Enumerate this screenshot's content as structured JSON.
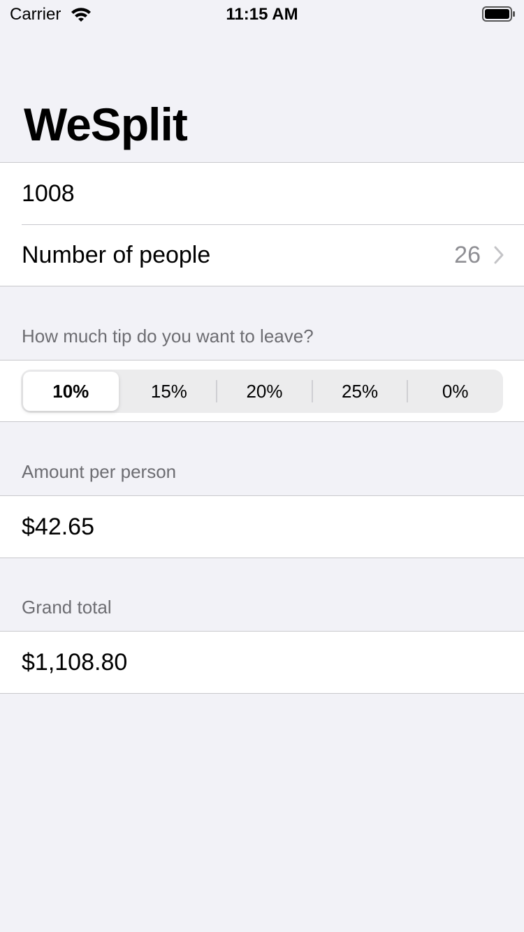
{
  "status_bar": {
    "carrier": "Carrier",
    "time": "11:15 AM"
  },
  "nav": {
    "title": "WeSplit"
  },
  "form": {
    "check_amount_value": "1008",
    "people_label": "Number of people",
    "people_value": "26"
  },
  "tip": {
    "header": "How much tip do you want to leave?",
    "options": [
      "10%",
      "15%",
      "20%",
      "25%",
      "0%"
    ],
    "selected": "10%"
  },
  "amount_per_person": {
    "header": "Amount per person",
    "value": "$42.65"
  },
  "grand_total": {
    "header": "Grand total",
    "value": "$1,108.80"
  },
  "colors": {
    "background": "#f2f2f7",
    "cell": "#ffffff",
    "secondary_text": "#8e8e93",
    "header_text": "#6d6d72"
  },
  "icons": [
    "wifi-icon",
    "battery-icon",
    "chevron-right-icon"
  ]
}
